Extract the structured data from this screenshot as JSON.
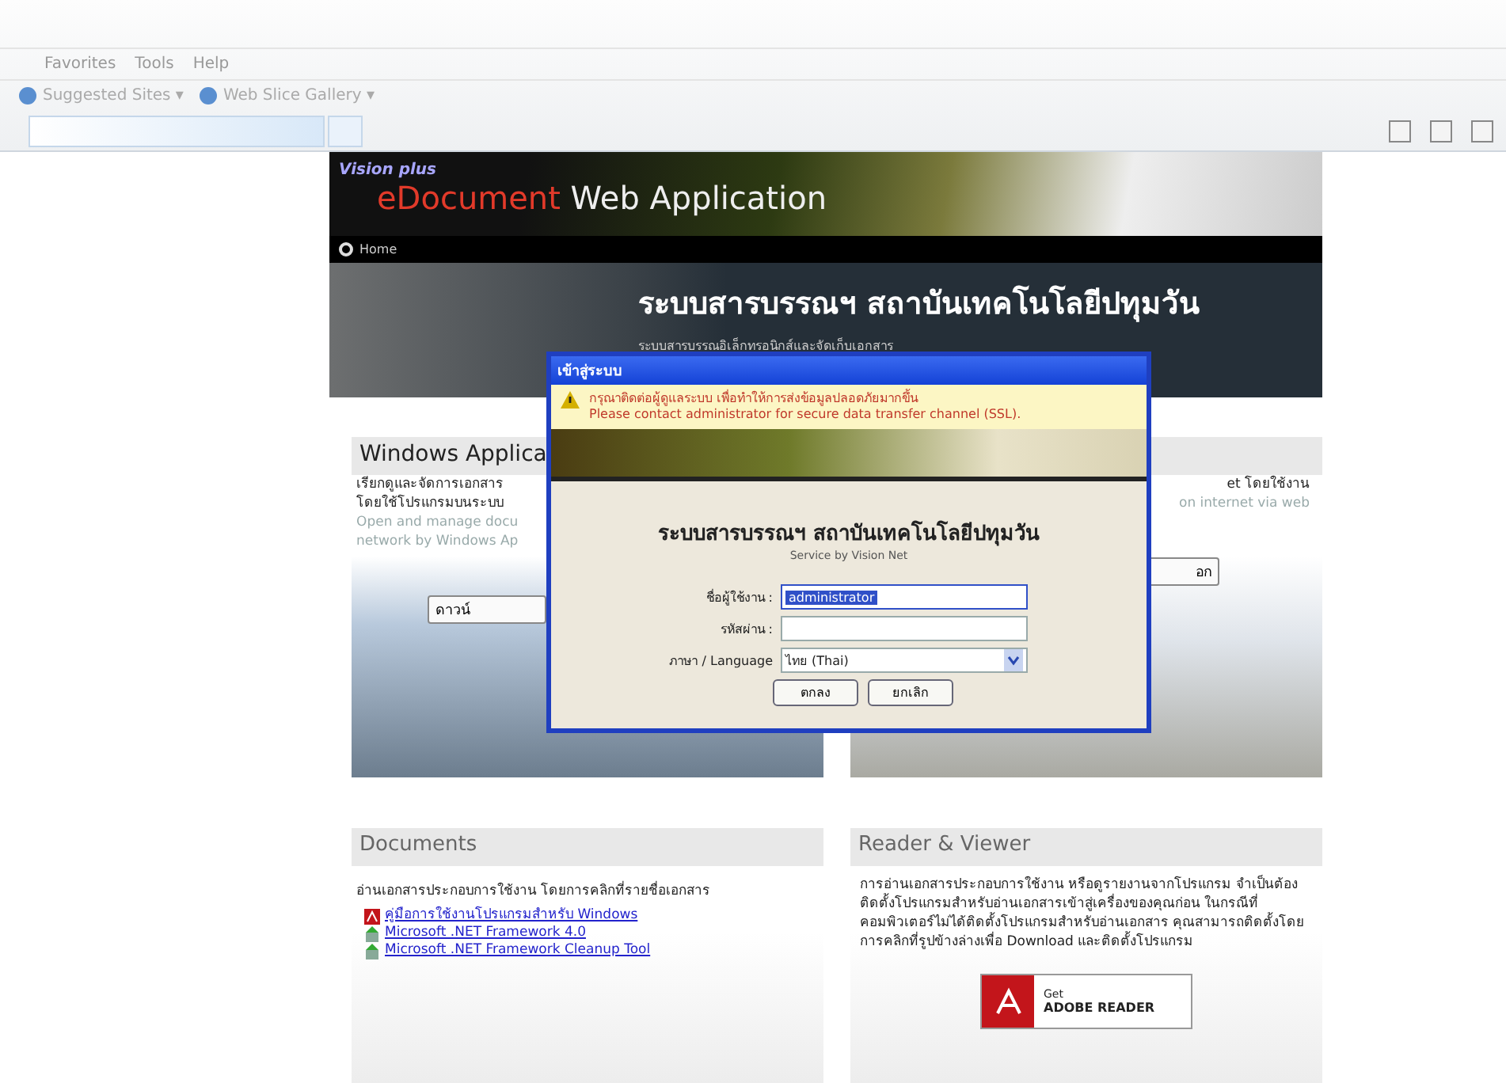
{
  "browser": {
    "menu": [
      "Favorites",
      "Tools",
      "Help"
    ],
    "favorites": [
      {
        "label": "Suggested Sites ▾"
      },
      {
        "label": "Web Slice Gallery ▾"
      }
    ]
  },
  "header": {
    "brand": "Vision plus",
    "title_accent": "eDocument",
    "title_rest": "Web Application",
    "nav": "Home"
  },
  "hero": {
    "title": "ระบบสารบรรณฯ สถาบันเทคโนโลยีปทุมวัน",
    "subtitle": "ระบบสารบรรณอิเล็กทรอนิกส์และจัดเก็บเอกสาร"
  },
  "windows_card": {
    "title": "Windows Applica",
    "lines": [
      "เรียกดูและจัดการเอกสาร",
      "โดยใช้โปรแกรมบนระบบ"
    ],
    "lines_en": [
      "Open and manage docu",
      "network by Windows Ap"
    ],
    "button": "ดาวน์"
  },
  "web_card": {
    "lines": [
      "et โดยใช้งาน"
    ],
    "lines_en": [
      "on internet via web"
    ],
    "button": "อก"
  },
  "documents": {
    "title": "Documents",
    "intro": "อ่านเอกสารประกอบการใช้งาน โดยการคลิกที่รายชื่อเอกสาร",
    "links": [
      {
        "kind": "pdf",
        "label": "คู่มือการใช้งานโปรแกรมสำหรับ Windows"
      },
      {
        "kind": "setup",
        "label": "Microsoft .NET Framework 4.0"
      },
      {
        "kind": "setup",
        "label": "Microsoft .NET Framework Cleanup Tool"
      }
    ]
  },
  "reader": {
    "title": "Reader & Viewer",
    "text": "การอ่านเอกสารประกอบการใช้งาน หรือดูรายงานจากโปรแกรม จำเป็นต้องติดตั้งโปรแกรมสำหรับอ่านเอกสารเข้าสู่เครื่องของคุณก่อน ในกรณีที่คอมพิวเตอร์ไม่ได้ติดตั้งโปรแกรมสำหรับอ่านเอกสาร คุณสามารถติดตั้งโดยการคลิกที่รูปข้างล่างเพื่อ Download และติดตั้งโปรแกรม",
    "badge_top": "Get",
    "badge_bottom": "ADOBE READER"
  },
  "dialog": {
    "title": "เข้าสู่ระบบ",
    "warning": [
      "กรุณาติดต่อผู้ดูแลระบบ เพื่อทำให้การส่งข้อมูลปลอดภัยมากขึ้น",
      "Please contact administrator for secure data transfer channel (SSL)."
    ],
    "heading": "ระบบสารบรรณฯ สถาบันเทคโนโลยีปทุมวัน",
    "service": "Service by Vision Net",
    "fields": [
      {
        "kind": "text",
        "label": "ชื่อผู้ใช้งาน :",
        "value": "administrator",
        "selected": true
      },
      {
        "kind": "password",
        "label": "รหัสผ่าน :",
        "selected": false
      },
      {
        "kind": "select",
        "label": "ภาษา / Language",
        "value": "ไทย (Thai)",
        "selected": false
      }
    ],
    "buttons": [
      "ตกลง",
      "ยกเลิก"
    ]
  }
}
